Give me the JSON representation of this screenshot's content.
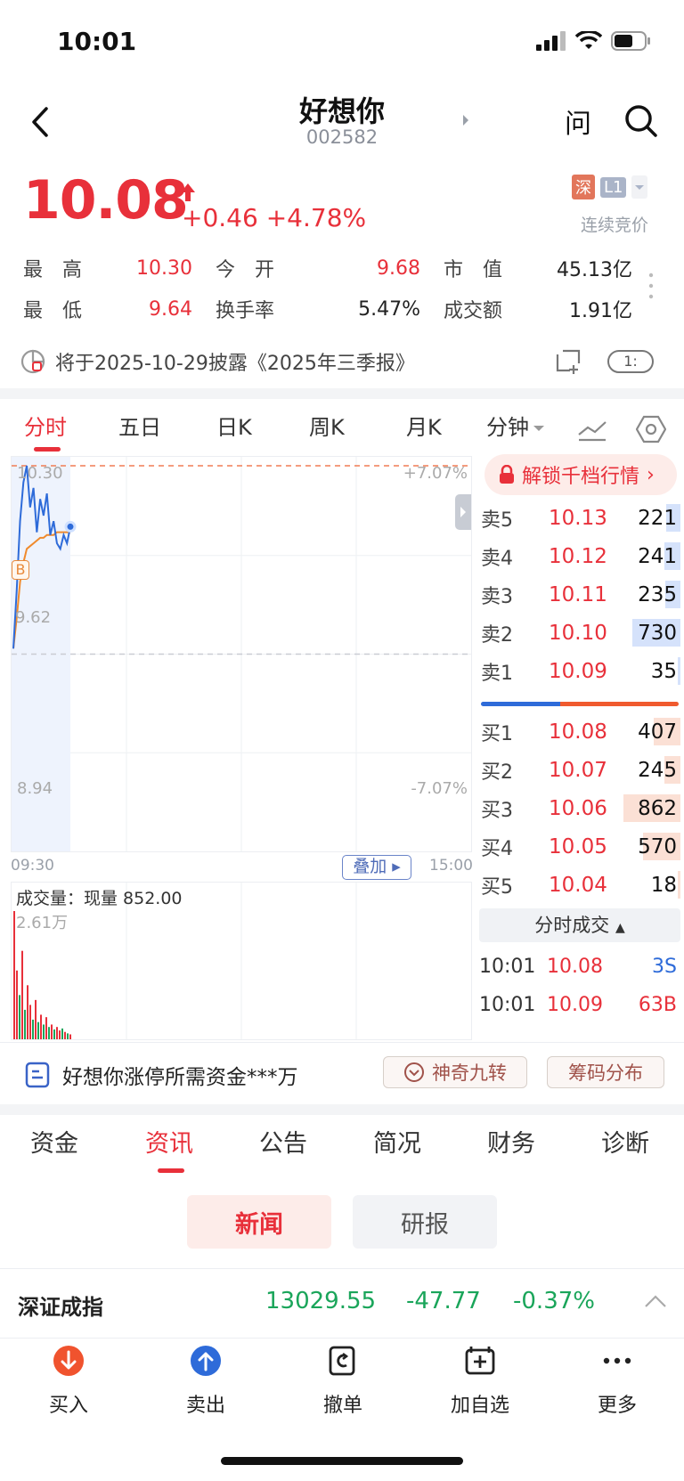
{
  "status": {
    "time": "10:01"
  },
  "nav": {
    "title": "好想你",
    "code": "002582",
    "ask_label": "问"
  },
  "quote": {
    "price": "10.08",
    "change": "+0.46",
    "change_pct": "+4.78%",
    "exchange_badge": "深",
    "level_badge": "L1",
    "session": "连续竞价",
    "colors": {
      "up": "#e8303a",
      "down": "#1aa55a"
    },
    "stats": [
      [
        {
          "label": "最　高",
          "value": "10.30",
          "tone": "red"
        },
        {
          "label": "今　开",
          "value": "9.68",
          "tone": "red"
        },
        {
          "label": "市　值",
          "value": "45.13亿",
          "tone": "dark"
        }
      ],
      [
        {
          "label": "最　低",
          "value": "9.64",
          "tone": "red"
        },
        {
          "label": "换手率",
          "value": "5.47%",
          "tone": "dark"
        },
        {
          "label": "成交额",
          "value": "1.91亿",
          "tone": "dark"
        }
      ]
    ]
  },
  "disclosure": {
    "text": "将于2025-10-29披露《2025年三季报》",
    "counter": "1"
  },
  "chart_tabs": [
    "分时",
    "五日",
    "日K",
    "周K",
    "月K",
    "分钟"
  ],
  "intraday": {
    "price_high": "10.30",
    "price_prev_close": "9.62",
    "price_low": "8.94",
    "pct_high": "+7.07%",
    "pct_low": "-7.07%",
    "time_start": "09:30",
    "time_end": "15:00",
    "overlay_label": "叠加",
    "buy_marker": "B",
    "volume_label": "成交量：现量 852.00",
    "volume_max": "2.61万"
  },
  "chart_data": {
    "type": "line",
    "title": "",
    "ylim": [
      8.94,
      10.3
    ],
    "series": [
      {
        "values": [
          9.64,
          9.85,
          10.1,
          10.24,
          10.3,
          10.15,
          10.22,
          10.06,
          10.18,
          10.12,
          10.2,
          10.05,
          10.1,
          10.02,
          10.0,
          10.05,
          10.02,
          10.08
        ]
      },
      {
        "values": [
          9.64,
          9.75,
          9.88,
          9.95,
          10.0,
          10.01,
          10.02,
          10.03,
          10.04,
          10.04,
          10.05,
          10.05,
          10.05,
          10.06,
          10.06,
          10.06,
          10.06,
          10.06
        ]
      }
    ],
    "volumes": [
      {
        "v": 2.61,
        "dir": "up"
      },
      {
        "v": 1.4,
        "dir": "up"
      },
      {
        "v": 0.9,
        "dir": "down"
      },
      {
        "v": 1.8,
        "dir": "up"
      },
      {
        "v": 0.6,
        "dir": "down"
      },
      {
        "v": 1.1,
        "dir": "up"
      },
      {
        "v": 0.7,
        "dir": "up"
      },
      {
        "v": 0.4,
        "dir": "down"
      },
      {
        "v": 0.8,
        "dir": "up"
      },
      {
        "v": 0.35,
        "dir": "down"
      },
      {
        "v": 0.5,
        "dir": "up"
      },
      {
        "v": 0.3,
        "dir": "down"
      },
      {
        "v": 0.45,
        "dir": "up"
      },
      {
        "v": 0.25,
        "dir": "down"
      },
      {
        "v": 0.3,
        "dir": "up"
      },
      {
        "v": 0.2,
        "dir": "down"
      },
      {
        "v": 0.25,
        "dir": "up"
      },
      {
        "v": 0.18,
        "dir": "up"
      },
      {
        "v": 0.22,
        "dir": "down"
      },
      {
        "v": 0.15,
        "dir": "up"
      },
      {
        "v": 0.12,
        "dir": "down"
      },
      {
        "v": 0.1,
        "dir": "up"
      }
    ]
  },
  "order_book": {
    "unlock_label": "解锁千档行情",
    "asks": [
      {
        "label": "卖5",
        "price": "10.13",
        "volume": "221",
        "level": 221
      },
      {
        "label": "卖4",
        "price": "10.12",
        "volume": "241",
        "level": 241
      },
      {
        "label": "卖3",
        "price": "10.11",
        "volume": "235",
        "level": 235
      },
      {
        "label": "卖2",
        "price": "10.10",
        "volume": "730",
        "level": 730
      },
      {
        "label": "卖1",
        "price": "10.09",
        "volume": "35",
        "level": 35
      }
    ],
    "bids": [
      {
        "label": "买1",
        "price": "10.08",
        "volume": "407",
        "level": 407
      },
      {
        "label": "买2",
        "price": "10.07",
        "volume": "245",
        "level": 245
      },
      {
        "label": "买3",
        "price": "10.06",
        "volume": "862",
        "level": 862
      },
      {
        "label": "买4",
        "price": "10.05",
        "volume": "570",
        "level": 570
      },
      {
        "label": "买5",
        "price": "10.04",
        "volume": "18",
        "level": 18
      }
    ],
    "buy_sell_ratio": 0.4,
    "ticks_label": "分时成交",
    "ticks": [
      {
        "time": "10:01",
        "price": "10.08",
        "volume": "3S",
        "side": "sell"
      },
      {
        "time": "10:01",
        "price": "10.09",
        "volume": "63B",
        "side": "buy"
      }
    ]
  },
  "limit_up": {
    "text": "好想你涨停所需资金***万",
    "btn_nine": "神奇九转",
    "btn_chips": "筹码分布"
  },
  "section_tabs": [
    "资金",
    "资讯",
    "公告",
    "简况",
    "财务",
    "诊断"
  ],
  "sub_tabs": {
    "news": "新闻",
    "reports": "研报"
  },
  "index": {
    "name": "深证成指",
    "value": "13029.55",
    "change": "-47.77",
    "change_pct": "-0.37%"
  },
  "toolbar": {
    "buy": "买入",
    "sell": "卖出",
    "cancel": "撤单",
    "add_watch": "加自选",
    "more": "更多"
  }
}
